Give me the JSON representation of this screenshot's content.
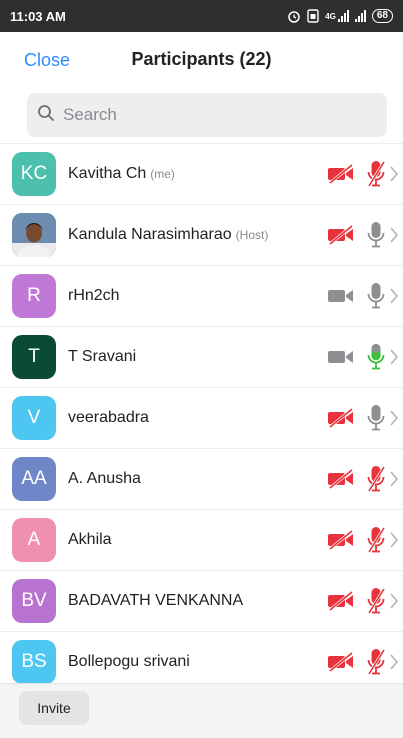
{
  "status_bar": {
    "time": "11:03 AM",
    "network": "4G",
    "battery": "68"
  },
  "header": {
    "close_label": "Close",
    "title": "Participants (22)"
  },
  "search": {
    "placeholder": "Search"
  },
  "participants": [
    {
      "initials": "KC",
      "name": "Kavitha Ch",
      "role": "(me)",
      "avatar_color": "#4cbfad",
      "photo": false,
      "video": "off",
      "mic": "muted"
    },
    {
      "initials": "",
      "name": "Kandula Narasimharao",
      "role": "(Host)",
      "avatar_color": "#5b7fa6",
      "photo": true,
      "video": "off",
      "mic": "on"
    },
    {
      "initials": "R",
      "name": "rHn2ch",
      "role": "",
      "avatar_color": "#c078d6",
      "photo": false,
      "video": "on",
      "mic": "on"
    },
    {
      "initials": "T",
      "name": "T Sravani",
      "role": "",
      "avatar_color": "#0c4a38",
      "photo": false,
      "video": "on",
      "mic": "speaking"
    },
    {
      "initials": "V",
      "name": "veerabadra",
      "role": "",
      "avatar_color": "#4ec6f2",
      "photo": false,
      "video": "off",
      "mic": "on"
    },
    {
      "initials": "AA",
      "name": "A. Anusha",
      "role": "",
      "avatar_color": "#6f87c9",
      "photo": false,
      "video": "off",
      "mic": "muted"
    },
    {
      "initials": "A",
      "name": "Akhila",
      "role": "",
      "avatar_color": "#ef8fb1",
      "photo": false,
      "video": "off",
      "mic": "muted"
    },
    {
      "initials": "BV",
      "name": "BADAVATH VENKANNA",
      "role": "",
      "avatar_color": "#b872cf",
      "photo": false,
      "video": "off",
      "mic": "muted"
    },
    {
      "initials": "BS",
      "name": "Bollepogu srivani",
      "role": "",
      "avatar_color": "#4ec6f2",
      "photo": false,
      "video": "off",
      "mic": "muted"
    }
  ],
  "colors": {
    "accent": "#2d8cff",
    "muted_red": "#e8333d",
    "icon_gray": "#8e8e93",
    "speaking_green": "#3cc13b"
  },
  "footer": {
    "invite_label": "Invite"
  }
}
